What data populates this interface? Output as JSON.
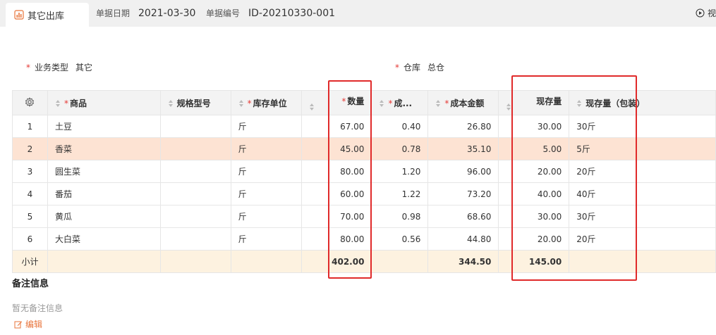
{
  "tab": {
    "label": "其它出库",
    "icon": "bar-chart-icon"
  },
  "header": {
    "date_label": "单据日期",
    "date_value": "2021-03-30",
    "no_label": "单据编号",
    "no_value": "ID-20210330-001",
    "right_button_label": "视"
  },
  "form": {
    "biz_type_label": "业务类型",
    "biz_type_value": "其它",
    "warehouse_label": "仓库",
    "warehouse_value": "总仓"
  },
  "table": {
    "columns": [
      "商品",
      "规格型号",
      "库存单位",
      "数量",
      "成...",
      "成本金额",
      "现存量",
      "现存量（包装）"
    ],
    "rows": [
      {
        "idx": "1",
        "product": "土豆",
        "spec": "",
        "unit": "斤",
        "qty": "67.00",
        "cost": "0.40",
        "amount": "26.80",
        "stock": "30.00",
        "stock_pkg": "30斤"
      },
      {
        "idx": "2",
        "product": "香菜",
        "spec": "",
        "unit": "斤",
        "qty": "45.00",
        "cost": "0.78",
        "amount": "35.10",
        "stock": "5.00",
        "stock_pkg": "5斤"
      },
      {
        "idx": "3",
        "product": "圆生菜",
        "spec": "",
        "unit": "斤",
        "qty": "80.00",
        "cost": "1.20",
        "amount": "96.00",
        "stock": "20.00",
        "stock_pkg": "20斤"
      },
      {
        "idx": "4",
        "product": "番茄",
        "spec": "",
        "unit": "斤",
        "qty": "60.00",
        "cost": "1.22",
        "amount": "73.20",
        "stock": "40.00",
        "stock_pkg": "40斤"
      },
      {
        "idx": "5",
        "product": "黄瓜",
        "spec": "",
        "unit": "斤",
        "qty": "70.00",
        "cost": "0.98",
        "amount": "68.60",
        "stock": "30.00",
        "stock_pkg": "30斤"
      },
      {
        "idx": "6",
        "product": "大白菜",
        "spec": "",
        "unit": "斤",
        "qty": "80.00",
        "cost": "0.56",
        "amount": "44.80",
        "stock": "20.00",
        "stock_pkg": "20斤"
      }
    ],
    "subtotal": {
      "label": "小计",
      "qty": "402.00",
      "amount": "344.50",
      "stock": "145.00"
    }
  },
  "notes": {
    "title": "备注信息",
    "empty_text": "暂无备注信息",
    "edit_label": "编辑"
  },
  "colors": {
    "accent": "#e8743b",
    "required": "#e53935",
    "highlight_row": "#fde3d3",
    "subtotal_row": "#fdf2e0",
    "annotation_box": "#e02a2a"
  }
}
